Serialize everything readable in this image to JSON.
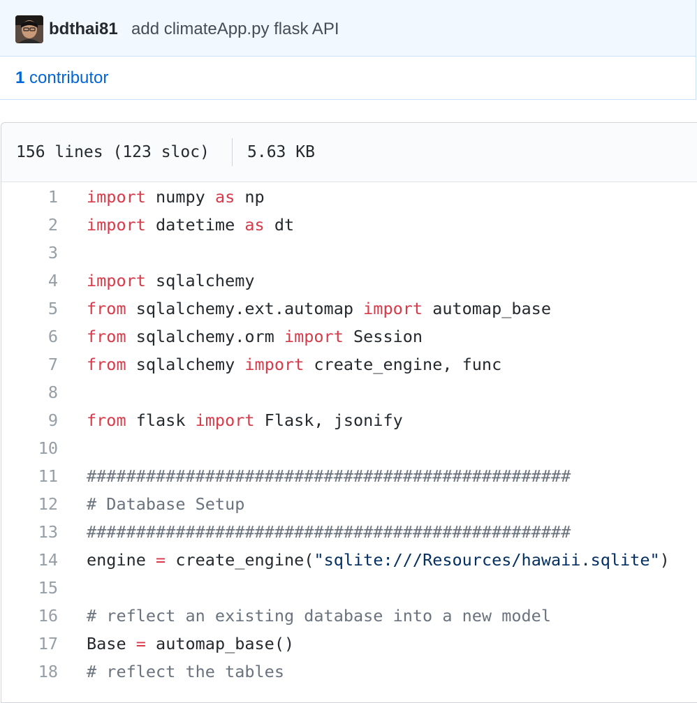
{
  "commit": {
    "author": "bdthai81",
    "message": "add climateApp.py flask API"
  },
  "contributors": {
    "count": "1",
    "label": "contributor"
  },
  "file": {
    "lines_info": "156 lines (123 sloc)",
    "size": "5.63 KB"
  },
  "code": {
    "lines": [
      {
        "num": "1",
        "tokens": [
          {
            "t": "import",
            "c": "kw"
          },
          {
            "t": " numpy ",
            "c": ""
          },
          {
            "t": "as",
            "c": "kw"
          },
          {
            "t": " np",
            "c": ""
          }
        ]
      },
      {
        "num": "2",
        "tokens": [
          {
            "t": "import",
            "c": "kw"
          },
          {
            "t": " datetime ",
            "c": ""
          },
          {
            "t": "as",
            "c": "kw"
          },
          {
            "t": " dt",
            "c": ""
          }
        ]
      },
      {
        "num": "3",
        "tokens": []
      },
      {
        "num": "4",
        "tokens": [
          {
            "t": "import",
            "c": "kw"
          },
          {
            "t": " sqlalchemy",
            "c": ""
          }
        ]
      },
      {
        "num": "5",
        "tokens": [
          {
            "t": "from",
            "c": "kw"
          },
          {
            "t": " sqlalchemy.ext.automap ",
            "c": ""
          },
          {
            "t": "import",
            "c": "kw"
          },
          {
            "t": " automap_base",
            "c": ""
          }
        ]
      },
      {
        "num": "6",
        "tokens": [
          {
            "t": "from",
            "c": "kw"
          },
          {
            "t": " sqlalchemy.orm ",
            "c": ""
          },
          {
            "t": "import",
            "c": "kw"
          },
          {
            "t": " Session",
            "c": ""
          }
        ]
      },
      {
        "num": "7",
        "tokens": [
          {
            "t": "from",
            "c": "kw"
          },
          {
            "t": " sqlalchemy ",
            "c": ""
          },
          {
            "t": "import",
            "c": "kw"
          },
          {
            "t": " create_engine, func",
            "c": ""
          }
        ]
      },
      {
        "num": "8",
        "tokens": []
      },
      {
        "num": "9",
        "tokens": [
          {
            "t": "from",
            "c": "kw"
          },
          {
            "t": " flask ",
            "c": ""
          },
          {
            "t": "import",
            "c": "kw"
          },
          {
            "t": " Flask, jsonify",
            "c": ""
          }
        ]
      },
      {
        "num": "10",
        "tokens": []
      },
      {
        "num": "11",
        "tokens": [
          {
            "t": "#################################################",
            "c": "cm"
          }
        ]
      },
      {
        "num": "12",
        "tokens": [
          {
            "t": "# Database Setup",
            "c": "cm"
          }
        ]
      },
      {
        "num": "13",
        "tokens": [
          {
            "t": "#################################################",
            "c": "cm"
          }
        ]
      },
      {
        "num": "14",
        "tokens": [
          {
            "t": "engine ",
            "c": ""
          },
          {
            "t": "=",
            "c": "op"
          },
          {
            "t": " create_engine(",
            "c": ""
          },
          {
            "t": "\"sqlite:///Resources/hawaii.sqlite\"",
            "c": "st"
          },
          {
            "t": ")",
            "c": ""
          }
        ]
      },
      {
        "num": "15",
        "tokens": []
      },
      {
        "num": "16",
        "tokens": [
          {
            "t": "# reflect an existing database into a new model",
            "c": "cm"
          }
        ]
      },
      {
        "num": "17",
        "tokens": [
          {
            "t": "Base ",
            "c": ""
          },
          {
            "t": "=",
            "c": "op"
          },
          {
            "t": " automap_base()",
            "c": ""
          }
        ]
      },
      {
        "num": "18",
        "tokens": [
          {
            "t": "# reflect the tables",
            "c": "cm"
          }
        ]
      }
    ]
  },
  "colors": {
    "keyword": "#d73a49",
    "comment": "#6a737d",
    "string": "#032f62",
    "link": "#0366d6",
    "line_number": "#959da5"
  }
}
